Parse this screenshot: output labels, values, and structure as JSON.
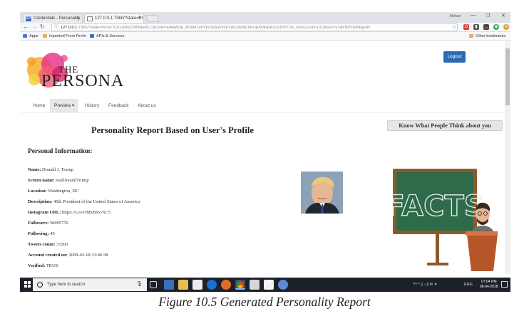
{
  "browser": {
    "tabs": [
      {
        "label": "Credentials - Personality",
        "favicon": "RPI"
      },
      {
        "label": "127.0.0.1:7360/?state=Pr"
      }
    ],
    "window_user": "Mohan",
    "url_host": "127.0.0.1",
    "url_rest": ":7360/?state=Pm3x7CKuSRbCW5Hke8LC&code=4/AAAYtp_BVaM7aPYbs7p8un35FYdrUq99fj7hFOEKMHEKG5cDOYUK_fUKG1FrfV-UC5NUeYu1AYfNTcIH5Fjgr4#",
    "bookmarks": {
      "apps": "Apps",
      "imported": "Imported From Firefo",
      "apis": "APIs & Services",
      "other": "Other bookmarks"
    }
  },
  "site": {
    "logo_the": "THE",
    "logo_persona": "PERSONA",
    "logout": "Logout",
    "nav": {
      "home": "Home",
      "preview": "Preview ▾",
      "history": "History",
      "feedback": "Feedback",
      "about": "About us"
    },
    "title": "Personality Report Based on User's Profile",
    "facts_button": "Know What People Think about you",
    "personal_heading": "Personal Information:",
    "board_text": "FACTS",
    "info": [
      {
        "label": "Name:",
        "value": "Donald J. Trump"
      },
      {
        "label": "Screen name:",
        "value": "realDonaldTrump"
      },
      {
        "label": "Location:",
        "value": "Washington, DC"
      },
      {
        "label": "Description:",
        "value": "45th President of the United States of America"
      },
      {
        "label": "Instagram URL:",
        "value": "https://t.co/OMxB0x7xC5"
      },
      {
        "label": "Followers:",
        "value": "50095776"
      },
      {
        "label": "Following:",
        "value": "45"
      },
      {
        "label": "Tweets count:",
        "value": "37260"
      },
      {
        "label": "Account created on:",
        "value": "2009-03-18 13:46:38"
      },
      {
        "label": "Verified:",
        "value": "TRUE"
      }
    ]
  },
  "taskbar": {
    "search_placeholder": "Type here to search",
    "lang": "ENG",
    "time": "07:04 PM",
    "date": "08-04-2018"
  },
  "caption": "Figure 10.5 Generated Personality Report"
}
